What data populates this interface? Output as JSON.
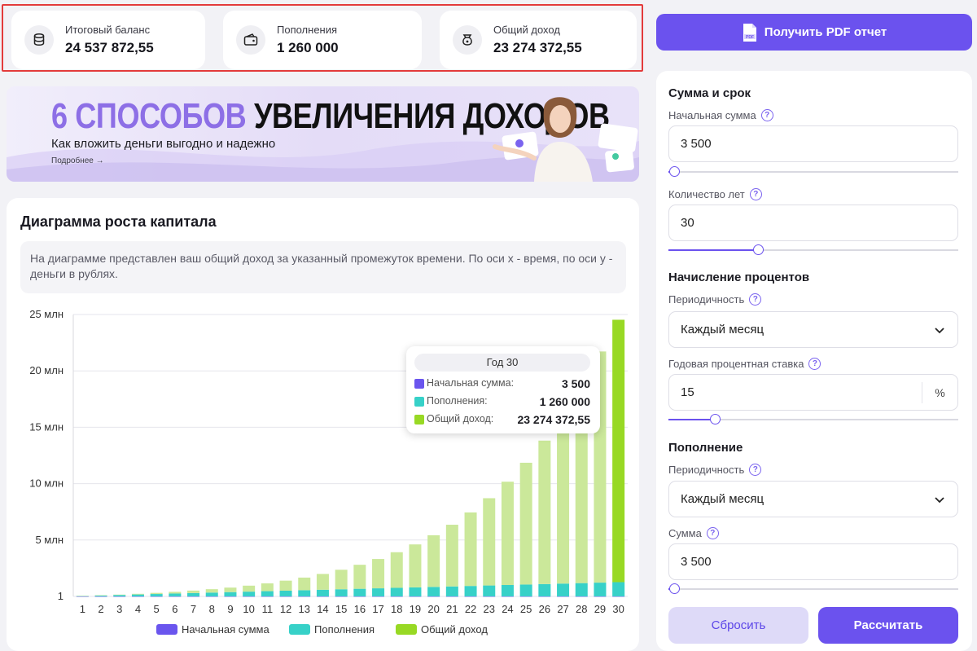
{
  "stats": [
    {
      "label": "Итоговый баланс",
      "value": "24 537 872,55",
      "icon": "coins-icon"
    },
    {
      "label": "Пополнения",
      "value": "1 260 000",
      "icon": "wallet-icon"
    },
    {
      "label": "Общий доход",
      "value": "23 274 372,55",
      "icon": "money-bag-icon"
    }
  ],
  "pdf_button": {
    "label": "Получить PDF отчет",
    "icon_text": "PDF"
  },
  "banner": {
    "title_accent": "6 СПОСОБОВ",
    "title_main": "УВЕЛИЧЕНИЯ ДОХОДОВ",
    "subtitle": "Как вложить деньги выгодно и надежно",
    "more": "Подробнее →"
  },
  "chart_card": {
    "title": "Диаграмма роста капитала",
    "description": "На диаграмме представлен ваш общий доход за указанный промежуток времени. По оси x - время, по оси y - деньги в рублях."
  },
  "tooltip": {
    "header": "Год 30",
    "rows": [
      {
        "label": "Начальная сумма:",
        "value": "3 500"
      },
      {
        "label": "Пополнения:",
        "value": "1 260 000"
      },
      {
        "label": "Общий доход:",
        "value": "23 274 372,55"
      }
    ]
  },
  "legend": [
    "Начальная сумма",
    "Пополнения",
    "Общий доход"
  ],
  "colors": {
    "initial": "#6a55ee",
    "deposits": "#37d1c8",
    "income": "#cbe89a",
    "income_active": "#98d924",
    "accent": "#6b52ee"
  },
  "chart_data": {
    "type": "bar",
    "stacked": true,
    "categories": [
      "1",
      "2",
      "3",
      "4",
      "5",
      "6",
      "7",
      "8",
      "9",
      "10",
      "11",
      "12",
      "13",
      "14",
      "15",
      "16",
      "17",
      "18",
      "19",
      "20",
      "21",
      "22",
      "23",
      "24",
      "25",
      "26",
      "27",
      "28",
      "29",
      "30"
    ],
    "yticks": [
      "1",
      "5 млн",
      "10 млн",
      "15 млн",
      "20 млн",
      "25 млн"
    ],
    "ytick_values": [
      0,
      5,
      10,
      15,
      20,
      25
    ],
    "ylim": [
      0,
      25
    ],
    "unit": "млн",
    "series": [
      {
        "name": "Начальная сумма",
        "values": [
          0.0035,
          0.0035,
          0.0035,
          0.0035,
          0.0035,
          0.0035,
          0.0035,
          0.0035,
          0.0035,
          0.0035,
          0.0035,
          0.0035,
          0.0035,
          0.0035,
          0.0035,
          0.0035,
          0.0035,
          0.0035,
          0.0035,
          0.0035,
          0.0035,
          0.0035,
          0.0035,
          0.0035,
          0.0035,
          0.0035,
          0.0035,
          0.0035,
          0.0035,
          0.0035
        ]
      },
      {
        "name": "Пополнения",
        "values": [
          0.042,
          0.084,
          0.126,
          0.168,
          0.21,
          0.252,
          0.294,
          0.336,
          0.378,
          0.42,
          0.462,
          0.504,
          0.546,
          0.588,
          0.63,
          0.672,
          0.714,
          0.756,
          0.798,
          0.84,
          0.882,
          0.924,
          0.966,
          1.008,
          1.05,
          1.092,
          1.134,
          1.176,
          1.218,
          1.26
        ]
      },
      {
        "name": "Общий доход",
        "values": [
          0.003,
          0.013,
          0.03,
          0.06,
          0.1,
          0.15,
          0.22,
          0.3,
          0.4,
          0.53,
          0.69,
          0.89,
          1.12,
          1.4,
          1.73,
          2.13,
          2.6,
          3.16,
          3.81,
          4.58,
          5.47,
          6.52,
          7.74,
          9.16,
          10.8,
          12.72,
          14.94,
          17.52,
          20.5,
          23.27
        ]
      }
    ],
    "active_category": "30",
    "grid": true,
    "legend_position": "bottom"
  },
  "form": {
    "section1": "Сумма и срок",
    "start_amount": {
      "label": "Начальная сумма",
      "value": "3 500",
      "slider": 0.02
    },
    "years": {
      "label": "Количество лет",
      "value": "30",
      "slider": 0.31
    },
    "section2": "Начисление процентов",
    "interest_period": {
      "label": "Периодичность",
      "value": "Каждый месяц"
    },
    "rate": {
      "label": "Годовая процентная ставка",
      "value": "15",
      "unit": "%",
      "slider": 0.16
    },
    "section3": "Пополнение",
    "topup_period": {
      "label": "Периодичность",
      "value": "Каждый месяц"
    },
    "topup_amount": {
      "label": "Сумма",
      "value": "3 500",
      "slider": 0.02
    },
    "help_glyph": "?",
    "reset": "Сбросить",
    "calculate": "Рассчитать"
  }
}
